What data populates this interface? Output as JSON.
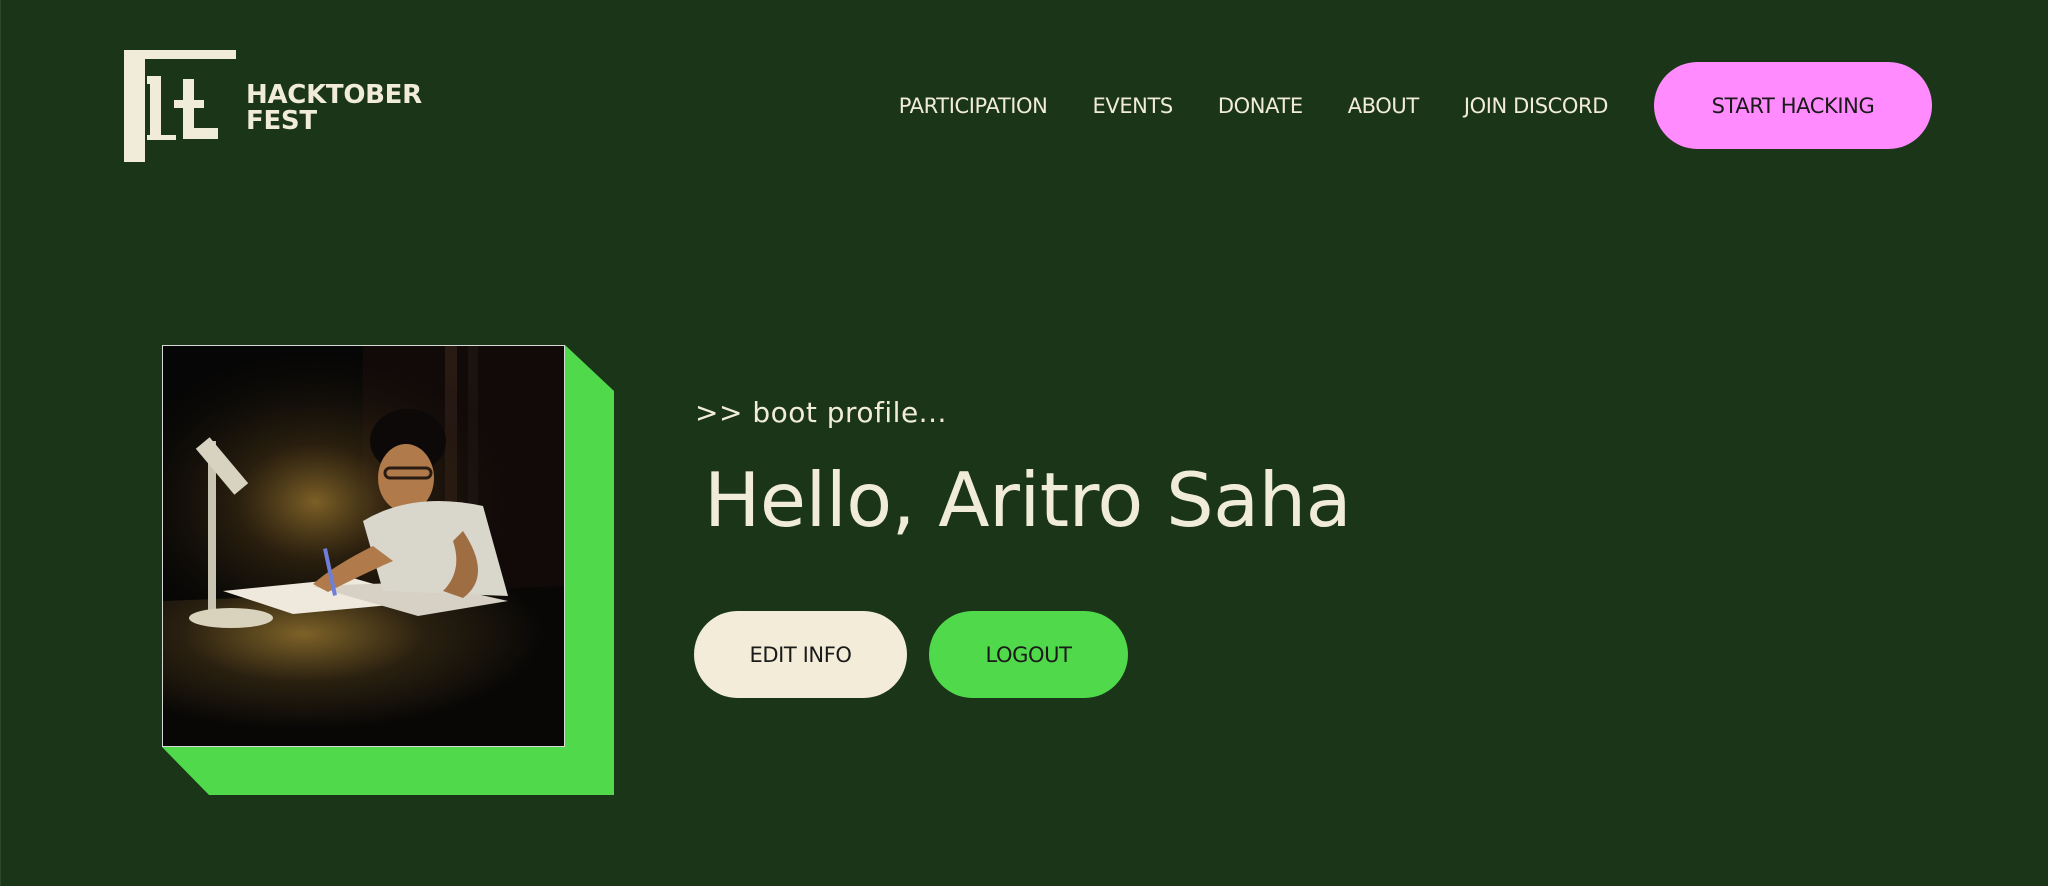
{
  "header": {
    "logo_line1": "HACKTOBER",
    "logo_line2": "FEST",
    "nav": [
      {
        "label": "PARTICIPATION"
      },
      {
        "label": "EVENTS"
      },
      {
        "label": "DONATE"
      },
      {
        "label": "ABOUT"
      },
      {
        "label": "JOIN DISCORD"
      }
    ],
    "cta_label": "START HACKING"
  },
  "profile": {
    "boot_text": ">> boot profile...",
    "greeting": "Hello, Aritro Saha",
    "edit_label": "EDIT INFO",
    "logout_label": "LOGOUT"
  },
  "colors": {
    "background": "#1a3518",
    "text": "#f1ecd9",
    "accent_pink": "#ff8bff",
    "accent_green": "#4fd94b",
    "cream": "#f2ecd9"
  },
  "icons": {
    "logo": "hacktoberfest-logo-icon"
  }
}
